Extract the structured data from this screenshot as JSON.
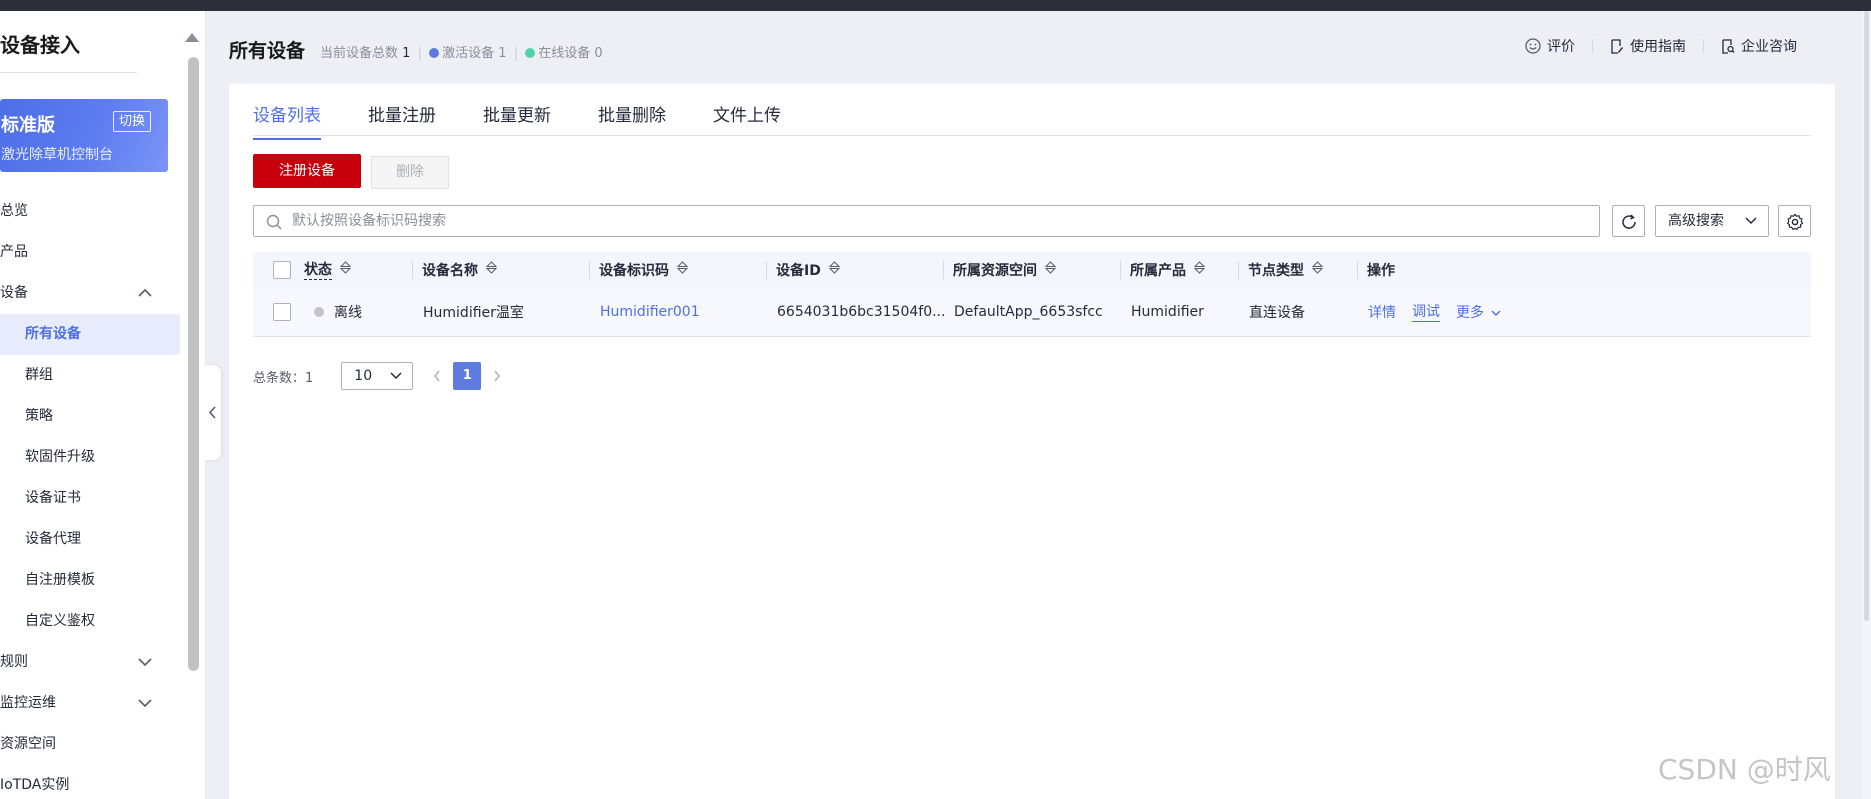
{
  "sidebar": {
    "title": "设备接入",
    "edition": {
      "name": "标准版",
      "switch_label": "切换",
      "instance_name": "激光除草机控制台"
    },
    "menu": [
      {
        "label": "总览",
        "type": "top"
      },
      {
        "label": "产品",
        "type": "top"
      },
      {
        "label": "设备",
        "type": "top",
        "expanded": true
      },
      {
        "label": "所有设备",
        "type": "child",
        "active": true
      },
      {
        "label": "群组",
        "type": "child"
      },
      {
        "label": "策略",
        "type": "child"
      },
      {
        "label": "软固件升级",
        "type": "child"
      },
      {
        "label": "设备证书",
        "type": "child"
      },
      {
        "label": "设备代理",
        "type": "child"
      },
      {
        "label": "自注册模板",
        "type": "child"
      },
      {
        "label": "自定义鉴权",
        "type": "child"
      },
      {
        "label": "规则",
        "type": "top",
        "expanded": false
      },
      {
        "label": "监控运维",
        "type": "top",
        "expanded": false
      },
      {
        "label": "资源空间",
        "type": "top"
      },
      {
        "label": "IoTDA实例",
        "type": "top"
      }
    ]
  },
  "header": {
    "title": "所有设备",
    "total_label": "当前设备总数",
    "total_value": "1",
    "active_label": "激活设备",
    "active_value": "1",
    "online_label": "在线设备",
    "online_value": "0",
    "links": {
      "rate": "评价",
      "guide": "使用指南",
      "consult": "企业咨询"
    }
  },
  "tabs": [
    "设备列表",
    "批量注册",
    "批量更新",
    "批量删除",
    "文件上传"
  ],
  "actions": {
    "register": "注册设备",
    "delete": "删除"
  },
  "search": {
    "placeholder": "默认按照设备标识码搜索",
    "value": ""
  },
  "advanced_search": "高级搜索",
  "table": {
    "columns": [
      "状态",
      "设备名称",
      "设备标识码",
      "设备ID",
      "所属资源空间",
      "所属产品",
      "节点类型",
      "操作"
    ],
    "rows": [
      {
        "status": "离线",
        "name": "Humidifier温室",
        "identifier": "Humidifier001",
        "device_id": "6654031b6bc31504f0...",
        "resource_space": "DefaultApp_6653sfcc",
        "product": "Humidifier",
        "node_type": "直连设备",
        "ops": {
          "detail": "详情",
          "debug": "调试",
          "more": "更多"
        }
      }
    ]
  },
  "pagination": {
    "total_label": "总条数：1",
    "page_size": "10",
    "current_page": "1"
  },
  "watermark": "CSDN @时风",
  "colors": {
    "primary_red": "#c7000b",
    "accent_blue": "#4d6fe8",
    "active_dot": "#5e7ce0",
    "online_dot": "#50d4ab"
  }
}
